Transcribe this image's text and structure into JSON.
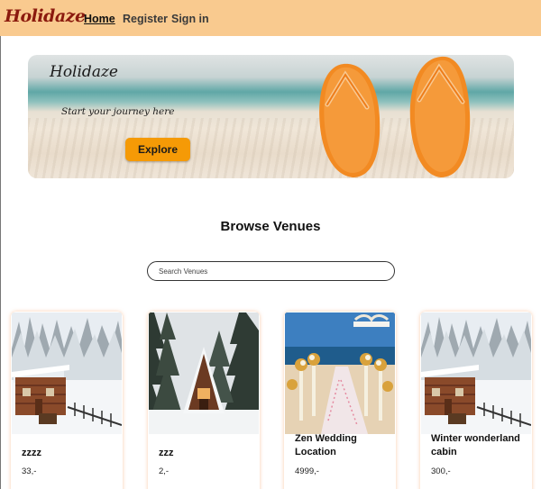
{
  "nav": {
    "logo": "Holidaze",
    "links": [
      "Home",
      "Register",
      "Sign in"
    ]
  },
  "hero": {
    "brand": "Holidaze",
    "tagline": "Start your journey here",
    "button": "Explore"
  },
  "section_title": "Browse Venues",
  "search": {
    "placeholder": "Search Venues"
  },
  "venues": [
    {
      "name": "zzzz",
      "price": "33,-"
    },
    {
      "name": "zzz",
      "price": "2,-"
    },
    {
      "name": "Zen Wedding Location",
      "price": "4999,-"
    },
    {
      "name": "Winter wonderland cabin",
      "price": "300,-"
    }
  ],
  "colors": {
    "navbar": "#f9ca8f",
    "accent": "#f59a06",
    "logo": "#8b1a0e"
  }
}
